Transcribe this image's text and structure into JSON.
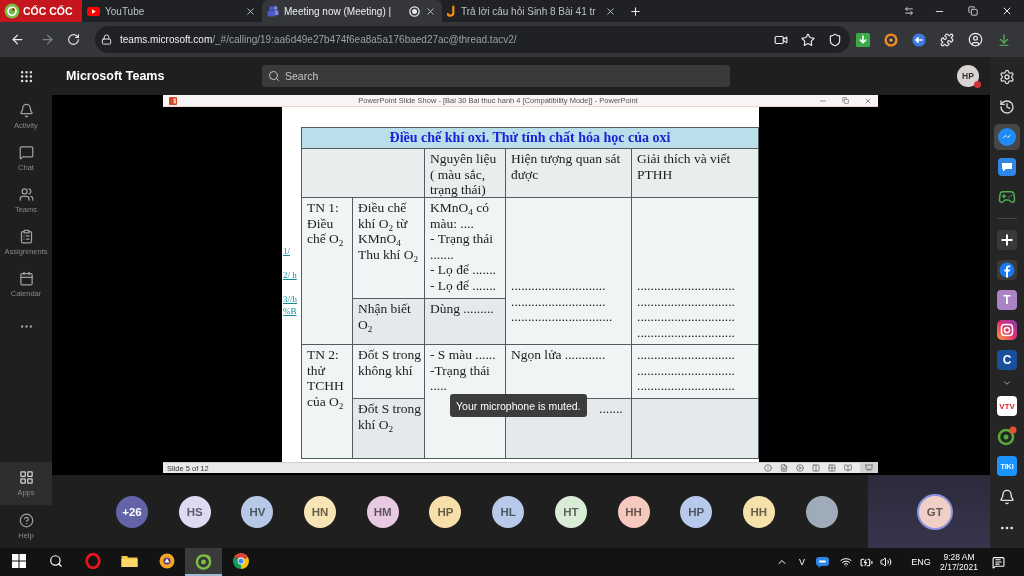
{
  "browser": {
    "brand": "CỐC CỐC",
    "tabs": [
      {
        "kind": "video",
        "title": "YouTube",
        "selected": false,
        "recording": false
      },
      {
        "kind": "meeting",
        "title": "Meeting now (Meeting) |",
        "selected": true,
        "recording": true
      },
      {
        "kind": "article",
        "title": "Trả lời câu hỏi Sinh 8 Bài 41 tr",
        "selected": false,
        "recording": false
      }
    ],
    "url": {
      "host": "teams.microsoft.com",
      "path": "/_#/calling/19:aa6d49e27b474f6ea8a5a176baed27ac@thread.tacv2/"
    }
  },
  "teams": {
    "title": "Microsoft Teams",
    "search": {
      "placeholder": "Search"
    },
    "me": {
      "initials": "HP",
      "busy": true
    },
    "rail": [
      {
        "kind": "activity",
        "label": "Activity",
        "selected": false
      },
      {
        "kind": "chat",
        "label": "Chat",
        "selected": false
      },
      {
        "kind": "teams",
        "label": "Teams",
        "selected": false
      },
      {
        "kind": "assignments",
        "label": "Assignments",
        "selected": false
      },
      {
        "kind": "calendar",
        "label": "Calendar",
        "selected": false
      }
    ],
    "rail_bottom": [
      {
        "kind": "apps",
        "label": "Apps",
        "selected": true
      },
      {
        "kind": "help",
        "label": "Help",
        "selected": false
      }
    ]
  },
  "presentation": {
    "window_title": "PowerPoint Slide Show - [Bai 30 Bai thuc hanh 4 [Compatibility Mode]] - PowerPoint",
    "links": [
      "1/",
      "2/ h",
      "3//h",
      "%B"
    ],
    "table": {
      "title": "Điều chế khí oxi. Thử tính chất hóa học của oxi",
      "columns": [
        "Nguyên liệu ( màu sắc, trạng thái)",
        "Hiện tượng quan sát được",
        "Giải thích và viết PTHH"
      ],
      "experiments": [
        {
          "name": "TN 1: Điều chế O$_{2}$",
          "observations": [
            "............................",
            "............................",
            ".............................."
          ],
          "explanations": [
            ".............................",
            ".............................",
            ".............................",
            "............................."
          ],
          "steps": [
            {
              "action": [
                "Điều chế khí O$_{2}$ từ KMnO$_{4}$",
                "Thu khí O$_{2}$"
              ],
              "materials": [
                "KMnO$_{4}$ có màu: ....",
                "- Trạng thái .......",
                "- Lọ để .......",
                "- Lọ để ......."
              ]
            },
            {
              "action": [
                "Nhận biết O$_{2}$"
              ],
              "materials": [
                "Dùng ........."
              ]
            }
          ]
        },
        {
          "name": "TN 2: thử TCHH của O$_{2}$",
          "materials": [
            "- S màu ......",
            "-Trạng thái ....."
          ],
          "steps": [
            {
              "action": [
                "Đốt S trong không khí"
              ],
              "observations": [
                "Ngọn lửa ............"
              ],
              "explanations": [
                ".............................",
                ".............................",
                "............................."
              ]
            },
            {
              "action": [
                "Đốt S trong khí O$_{2}$"
              ],
              "observations": [
                "......."
              ]
            }
          ]
        }
      ]
    },
    "status": "Slide 5 of 12"
  },
  "call": {
    "notice": "Your microphone is muted.",
    "participants": [
      {
        "kind": "overflow",
        "label": "+26"
      },
      {
        "kind": "initials",
        "label": "HS",
        "color": "#dedaf2"
      },
      {
        "kind": "initials",
        "label": "HV",
        "color": "#b6c8e6"
      },
      {
        "kind": "initials",
        "label": "HN",
        "color": "#f7e5b5"
      },
      {
        "kind": "initials",
        "label": "HM",
        "color": "#e8c9e3"
      },
      {
        "kind": "initials",
        "label": "HP",
        "color": "#f6dfa9"
      },
      {
        "kind": "initials",
        "label": "HL",
        "color": "#b8c9ea"
      },
      {
        "kind": "initials",
        "label": "HT",
        "color": "#d9edd6"
      },
      {
        "kind": "initials",
        "label": "HH",
        "color": "#f5c9bd"
      },
      {
        "kind": "initials",
        "label": "HP",
        "color": "#b7c9ea"
      },
      {
        "kind": "initials",
        "label": "HH",
        "color": "#f7e1ab"
      },
      {
        "kind": "photo"
      }
    ],
    "self": {
      "initials": "GT",
      "color": "#f0d0c6"
    }
  },
  "sidebar": [
    {
      "kind": "settings",
      "selected": false
    },
    {
      "kind": "history",
      "selected": false
    },
    {
      "kind": "messenger",
      "selected": true
    },
    {
      "kind": "chat",
      "selected": false
    },
    {
      "kind": "game",
      "selected": false
    },
    {
      "kind": "divider"
    },
    {
      "kind": "add",
      "selected": false
    },
    {
      "kind": "facebook",
      "selected": false
    },
    {
      "kind": "letter",
      "label": "T",
      "color": "#a983c4",
      "selected": false
    },
    {
      "kind": "camera",
      "selected": false
    },
    {
      "kind": "letter",
      "label": "C",
      "color": "#1a4f9c",
      "selected": false
    },
    {
      "kind": "expand",
      "selected": false
    },
    {
      "kind": "tv",
      "label": "VTV",
      "selected": false
    },
    {
      "kind": "leaf",
      "selected": false
    },
    {
      "kind": "shop",
      "label": "TIKI",
      "selected": false
    },
    {
      "kind": "bell",
      "selected": false
    },
    {
      "kind": "menu",
      "selected": false
    }
  ],
  "taskbar": {
    "apps": [
      {
        "kind": "opera",
        "active": false
      },
      {
        "kind": "folder",
        "active": false
      },
      {
        "kind": "browser",
        "active": false
      },
      {
        "kind": "leaf",
        "active": true
      },
      {
        "kind": "chrome",
        "active": false
      }
    ],
    "tray": {
      "keyboard": "V",
      "language": "ENG",
      "time": "9:28 AM",
      "date": "2/17/2021"
    }
  }
}
